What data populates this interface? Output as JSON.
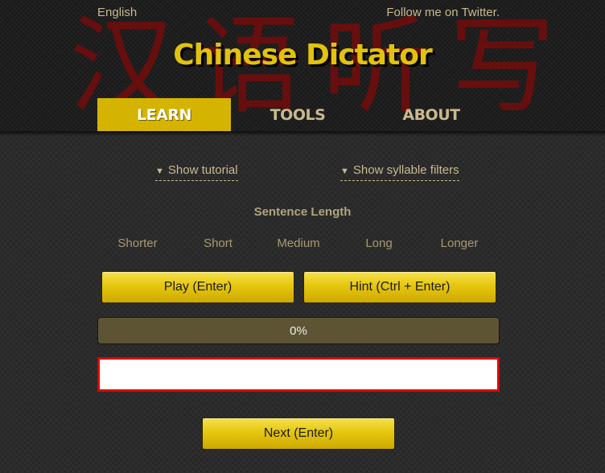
{
  "header": {
    "language_link": "English",
    "twitter_link": "Follow me on Twitter.",
    "title": "Chinese Dictator",
    "background_chars": [
      "汉",
      "语",
      "听",
      "写"
    ],
    "nav_tabs": [
      {
        "label": "LEARN",
        "active": true
      },
      {
        "label": "TOOLS",
        "active": false
      },
      {
        "label": "ABOUT",
        "active": false
      }
    ]
  },
  "toggles": {
    "tutorial": {
      "arrow": "▼",
      "label": "Show tutorial"
    },
    "filters": {
      "arrow": "▼",
      "label": "Show syllable filters"
    }
  },
  "sentence_length": {
    "label": "Sentence Length",
    "options": [
      "Shorter",
      "Short",
      "Medium",
      "Long",
      "Longer"
    ]
  },
  "buttons": {
    "play": "Play (Enter)",
    "hint": "Hint (Ctrl + Enter)",
    "next": "Next (Enter)"
  },
  "progress": {
    "value": 0,
    "text": "0%"
  },
  "answer": {
    "value": "",
    "placeholder": ""
  },
  "colors": {
    "accent": "#d4b400",
    "title": "#e2c20c",
    "text": "#c9b98e",
    "background_chars": "#6b0e0e",
    "input_border": "#e00000"
  }
}
